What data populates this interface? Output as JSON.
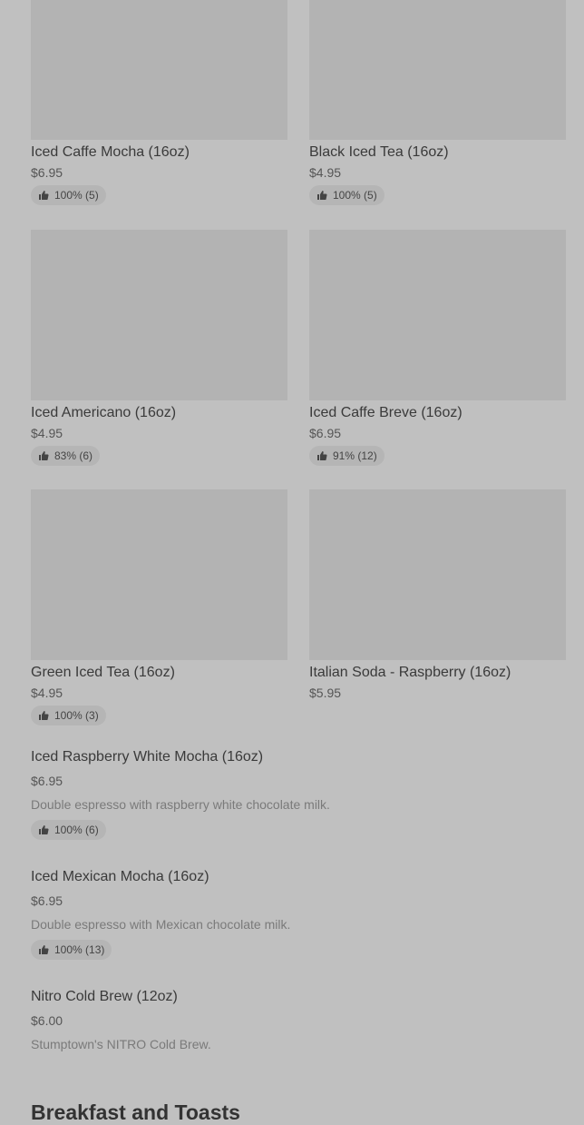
{
  "grid_items": [
    {
      "name": "Iced Caffe Mocha (16oz)",
      "price": "$6.95",
      "rating": "100% (5)"
    },
    {
      "name": "Black Iced Tea (16oz)",
      "price": "$4.95",
      "rating": "100% (5)"
    },
    {
      "name": "Iced Americano (16oz)",
      "price": "$4.95",
      "rating": "83% (6)"
    },
    {
      "name": "Iced Caffe Breve (16oz)",
      "price": "$6.95",
      "rating": "91% (12)"
    },
    {
      "name": "Green Iced Tea (16oz)",
      "price": "$4.95",
      "rating": "100% (3)"
    },
    {
      "name": "Italian Soda - Raspberry (16oz)",
      "price": "$5.95",
      "rating": ""
    }
  ],
  "list_items": [
    {
      "name": "Iced Raspberry White Mocha (16oz)",
      "price": "$6.95",
      "description": "Double espresso with raspberry white chocolate milk.",
      "rating": "100% (6)"
    },
    {
      "name": "Iced Mexican Mocha (16oz)",
      "price": "$6.95",
      "description": "Double espresso with Mexican chocolate milk.",
      "rating": "100% (13)"
    },
    {
      "name": "Nitro Cold Brew (12oz)",
      "price": "$6.00",
      "description": "Stumptown's NITRO Cold Brew.",
      "rating": ""
    }
  ],
  "section": {
    "title": "Breakfast and Toasts"
  },
  "icons": {
    "rating": "thumbs-up-icon"
  }
}
